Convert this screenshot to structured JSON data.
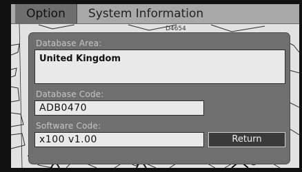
{
  "tabs": [
    {
      "label": "Option",
      "active": true
    },
    {
      "label": "System Information",
      "active": false
    }
  ],
  "map_label": "D4654",
  "database_area": {
    "label": "Database Area:",
    "value": "United Kingdom"
  },
  "database_code": {
    "label": "Database Code:",
    "value": "ADB0470"
  },
  "software_code": {
    "label": "Software Code:",
    "value": "x100 v1.00"
  },
  "return_label": "Return",
  "colors": {
    "panel": "#6f6f6f",
    "tabbar": "#a8a8a8",
    "active_tab": "#6e6e6e",
    "field": "#e9e9e9",
    "button": "#3a3a3a"
  }
}
